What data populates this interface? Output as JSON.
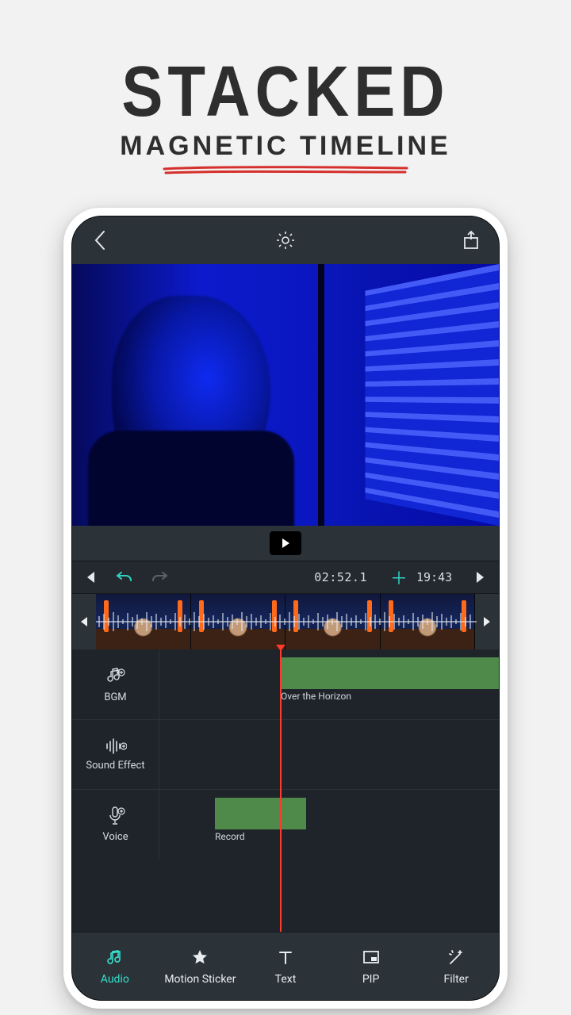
{
  "promo": {
    "title": "STACKED",
    "subtitle": "MAGNETIC TIMELINE"
  },
  "transport": {
    "current_time": "02:52.1",
    "duration": "19:43"
  },
  "tracks": {
    "bgm": {
      "label": "BGM",
      "clip_label": "Over the Horizon"
    },
    "sfx": {
      "label": "Sound Effect"
    },
    "voice": {
      "label": "Voice",
      "clip_label": "Record"
    }
  },
  "toolbar": {
    "audio": "Audio",
    "motion": "Motion Sticker",
    "text": "Text",
    "pip": "PIP",
    "filter": "Filter"
  }
}
